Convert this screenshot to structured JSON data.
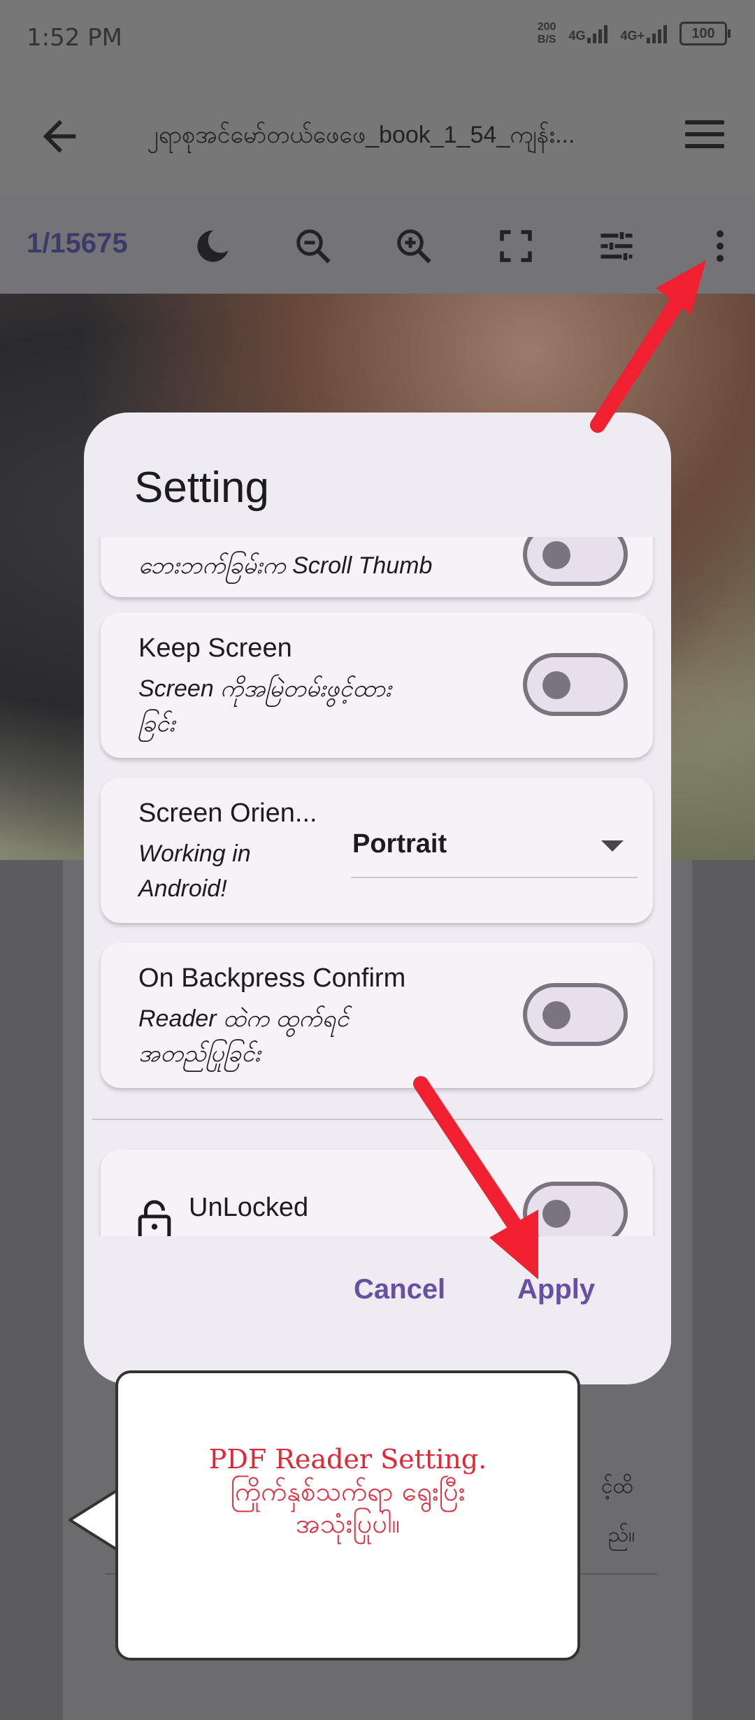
{
  "status_bar": {
    "time": "1:52 PM",
    "net_speed_value": "200",
    "net_speed_unit": "B/S",
    "signal1": "4G",
    "signal2": "4G+",
    "battery": "100"
  },
  "app_bar": {
    "title": "၂ရာစုအင်မော်တယ်ဖေဖေ_book_1_54_ကျန်း..."
  },
  "toolbar": {
    "page_indicator": "1/15675",
    "icons": [
      "moon-icon",
      "zoom-out-icon",
      "zoom-in-icon",
      "fullscreen-icon",
      "tune-icon",
      "more-vert-icon"
    ]
  },
  "dialog": {
    "title": "Setting",
    "items": [
      {
        "subtitle": "ဘေးဘက်ခြမ်းက Scroll Thumb",
        "toggle": false
      },
      {
        "title": "Keep Screen",
        "subtitle_line1": "Screen ကိုအမြဲတမ်းဖွင့်ထား",
        "subtitle_line2": "ခြင်း",
        "toggle": false
      },
      {
        "title": "Screen Orien...",
        "subtitle_line1": "Working in",
        "subtitle_line2": "Android!",
        "dropdown_value": "Portrait"
      },
      {
        "title": "On Backpress Confirm",
        "subtitle_line1": "Reader ထဲက ထွက်ရင်",
        "subtitle_line2": "အတည်ပြုခြင်း",
        "toggle": false
      },
      {
        "title": "UnLocked",
        "toggle": false
      }
    ],
    "cancel_label": "Cancel",
    "apply_label": "Apply"
  },
  "tooltip": {
    "line1": "PDF Reader Setting.",
    "line2": "ကြိုက်နှစ်သက်ရာ ရွေးပြီး",
    "line3": "အသုံးပြုပါ။"
  },
  "background_text": {
    "right1": "င့်ထိ",
    "right2": "ည်။"
  },
  "colors": {
    "accent": "#6650a4",
    "arrow": "#f02030",
    "tooltip_text": "#e02838"
  }
}
